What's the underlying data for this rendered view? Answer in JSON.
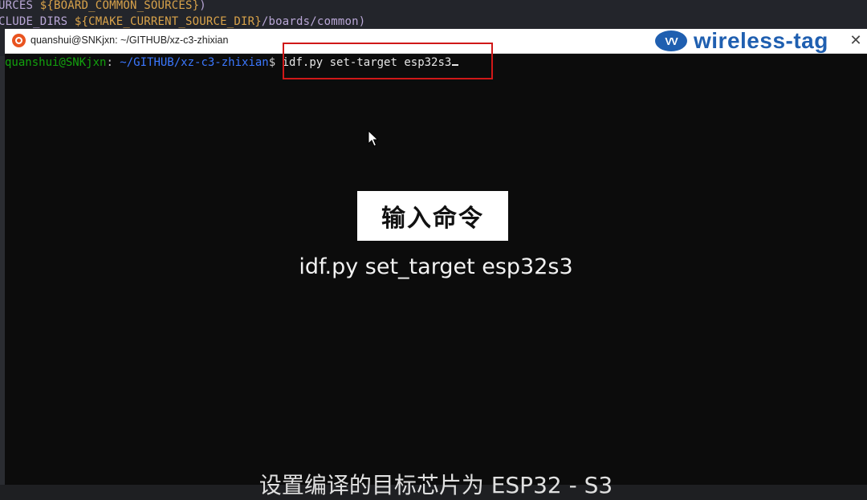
{
  "background_editor": {
    "line1_prefix": "URCES ",
    "line1_var": "${BOARD_COMMON_SOURCES}",
    "line1_suffix": ")",
    "line2_prefix": "CLUDE_DIRS ",
    "line2_var": "${CMAKE_CURRENT_SOURCE_DIR}",
    "line2_suffix": "/boards/common)"
  },
  "window": {
    "title": "quanshui@SNKjxn: ~/GITHUB/xz-c3-zhixian",
    "close_glyph": "✕"
  },
  "logo": {
    "mark": "VV",
    "text": "wireless-tag"
  },
  "terminal": {
    "user_host": "quanshui@SNKjxn",
    "separator": ":",
    "path": " ~/GITHUB/xz-c3-zhixian",
    "prompt_symbol": "$",
    "command": " idf.py set-target esp32s3"
  },
  "overlay": {
    "title": "输入命令",
    "command": "idf.py set_target esp32s3",
    "subtitle": "设置编译的目标芯片为 ESP32 - S3"
  },
  "colors": {
    "highlight_box": "#d01818",
    "prompt_user": "#13a10e",
    "prompt_path": "#3b78ff",
    "logo": "#1f5fb0"
  },
  "icons": {
    "app_icon": "ubuntu-icon",
    "pointer": "mouse-pointer-icon"
  }
}
